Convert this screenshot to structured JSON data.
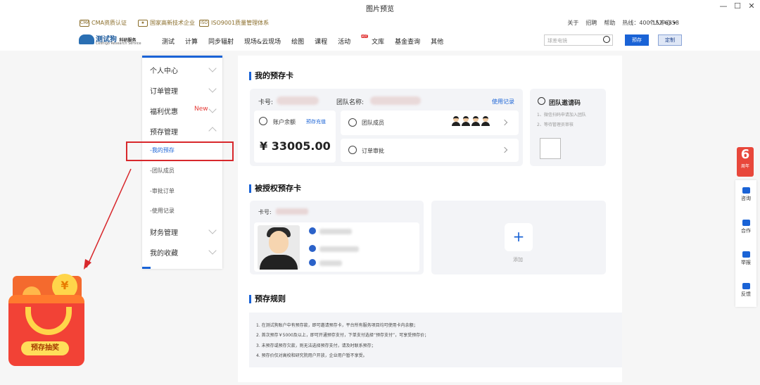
{
  "window": {
    "title": "图片预览",
    "controls": [
      "—",
      "☐",
      "✕"
    ]
  },
  "certs": [
    {
      "icon": "CMA",
      "label": "CMA资质认证"
    },
    {
      "icon": "★",
      "label": "国家高新技术企业"
    },
    {
      "icon": "ISO",
      "label": "ISO9001质量管理体系"
    }
  ],
  "toplinks": [
    "关于",
    "招聘",
    "帮助",
    "热线：400-152-6858"
  ],
  "user_menu": "个人中心 ▾",
  "logo": {
    "name": "测试狗",
    "tag": "科研服务",
    "sub": "Ceshigo Research Service"
  },
  "nav": [
    "测试",
    "计算",
    "同步辐射",
    "现场&云现场",
    "绘图",
    "课程",
    "活动",
    "文库",
    "基金查询",
    "其他"
  ],
  "nav_hot": "HOT",
  "search": {
    "placeholder": "球差电镜"
  },
  "header_buttons": {
    "prepay": "预存",
    "custom": "定制"
  },
  "sidebar": {
    "items": [
      "个人中心",
      "订单管理",
      "福利优惠",
      "预存管理",
      "财务管理",
      "我的收藏"
    ],
    "new_tag": "New",
    "sub_items": [
      "-我的预存",
      "-团队成员",
      "-审批订单",
      "-使用记录"
    ]
  },
  "my_card": {
    "title": "我的预存卡",
    "card_no_label": "卡号:",
    "team_label": "团队名称:",
    "usage_link": "使用记录",
    "balance_label": "账户余额",
    "recharge_link": "预存充值",
    "balance": "¥ 33005.00",
    "members_label": "团队成员",
    "approval_label": "订单审批",
    "invite_title": "团队邀请码",
    "invite_steps": [
      "1、微信扫码申请加入团队",
      "2、等待管理员审核"
    ]
  },
  "auth_card": {
    "title": "被授权预存卡",
    "card_no_label": "卡号:",
    "add_label": "添加"
  },
  "rules": {
    "title": "预存规则",
    "lines": [
      "1. 在测试狗账户中有预存款，即可邀请预存卡，平台所有服务项目均可使用卡内余额；",
      "2. 首次预存￥5000及以上，即可开通预存支付，下单支付选择“预存支付”，可享受预存价；",
      "3. 未预存或预存欠款，则无法选择预存支付，请及时联系预存；",
      "4. 预存价仅对高校和研究院用户开放，企业用户暂不享受。"
    ]
  },
  "promo": {
    "coin": "¥",
    "label": "预存抽奖"
  },
  "floating": {
    "anniv_num": "6",
    "anniv_text": "周年",
    "items": [
      "咨询",
      "合作",
      "举报",
      "反馈"
    ]
  },
  "colors": {
    "accent": "#1a63d6",
    "highlight": "#d8282c",
    "new": "#e53935"
  }
}
